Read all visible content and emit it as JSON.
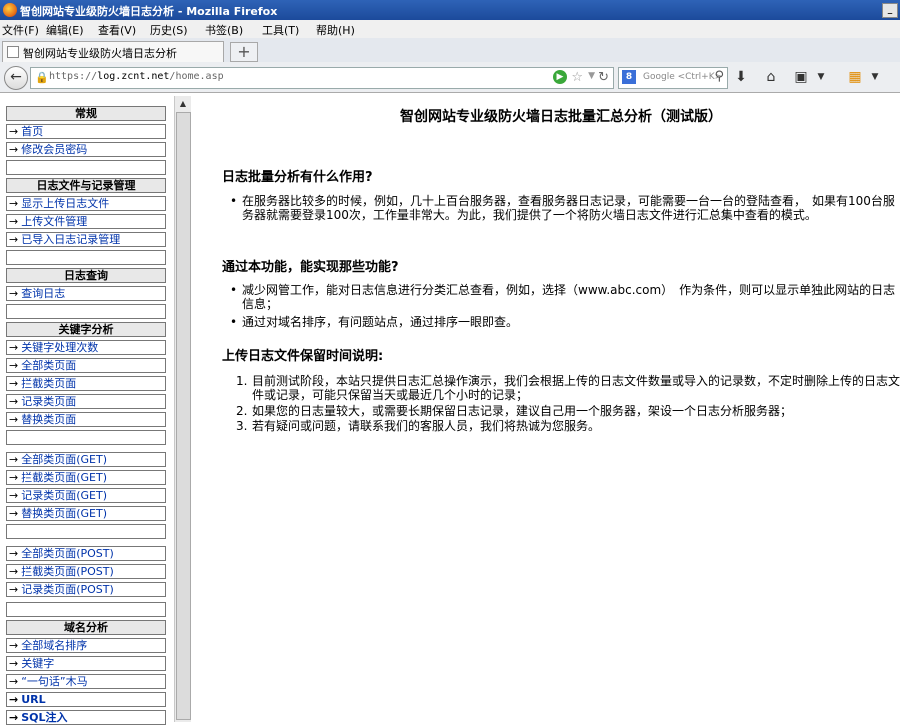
{
  "window": {
    "title": "智创网站专业级防火墙日志分析 - Mozilla Firefox"
  },
  "menu": [
    "文件(F)",
    "编辑(E)",
    "查看(V)",
    "历史(S)",
    "书签(B)",
    "工具(T)",
    "帮助(H)"
  ],
  "tab": {
    "title": "智创网站专业级防火墙日志分析",
    "new_tab": "+"
  },
  "nav": {
    "url_prefix": "https://",
    "url_host": "log.zcnt.net",
    "url_path": "/home.asp",
    "search_placeholder": "Google <Ctrl+K>"
  },
  "sidebar": {
    "sections": [
      {
        "header": "常规",
        "items": [
          "首页",
          "修改会员密码"
        ]
      },
      {
        "header": "日志文件与记录管理",
        "items": [
          "显示上传日志文件",
          "上传文件管理",
          "已导入日志记录管理"
        ]
      },
      {
        "header": "日志查询",
        "items": [
          "查询日志"
        ]
      },
      {
        "header": "关键字分析",
        "items": [
          "关键字处理次数",
          "全部类页面",
          "拦截类页面",
          "记录类页面",
          "替换类页面",
          "",
          "全部类页面(GET)",
          "拦截类页面(GET)",
          "记录类页面(GET)",
          "替换类页面(GET)",
          "",
          "全部类页面(POST)",
          "拦截类页面(POST)",
          "记录类页面(POST)"
        ]
      },
      {
        "header": "域名分析",
        "items": [
          "全部域名排序",
          "关键字",
          "“一句话”木马",
          "URL",
          "SQL注入"
        ]
      }
    ]
  },
  "content": {
    "title": "智创网站专业级防火墙日志批量汇总分析（测试版）",
    "sec1": {
      "heading": "日志批量分析有什么作用?",
      "bullets": [
        "在服务器比较多的时候，例如，几十上百台服务器，查看服务器日志记录，可能需要一台一台的登陆查看，　如果有100台服务器就需要登录100次，工作量非常大。为此，我们提供了一个将防火墙日志文件进行汇总集中查看的模式。"
      ]
    },
    "sec2": {
      "heading": "通过本功能，能实现那些功能?",
      "bullets": [
        "减少网管工作，能对日志信息进行分类汇总查看，例如，选择（www.abc.com）　作为条件，则可以显示单独此网站的日志信息；",
        "通过对域名排序，有问题站点，通过排序一眼即查。"
      ]
    },
    "sec3": {
      "heading": "上传日志文件保留时间说明:",
      "items": [
        "目前测试阶段，本站只提供日志汇总操作演示，我们会根据上传的日志文件数量或导入的记录数，不定时删除上传的日志文件或记录，可能只保留当天或最近几个小时的记录；",
        "如果您的日志量较大，或需要长期保留日志记录，建议自己用一个服务器，架设一个日志分析服务器；",
        "若有疑问或问题，请联系我们的客服人员，我们将热诚为您服务。"
      ]
    }
  }
}
